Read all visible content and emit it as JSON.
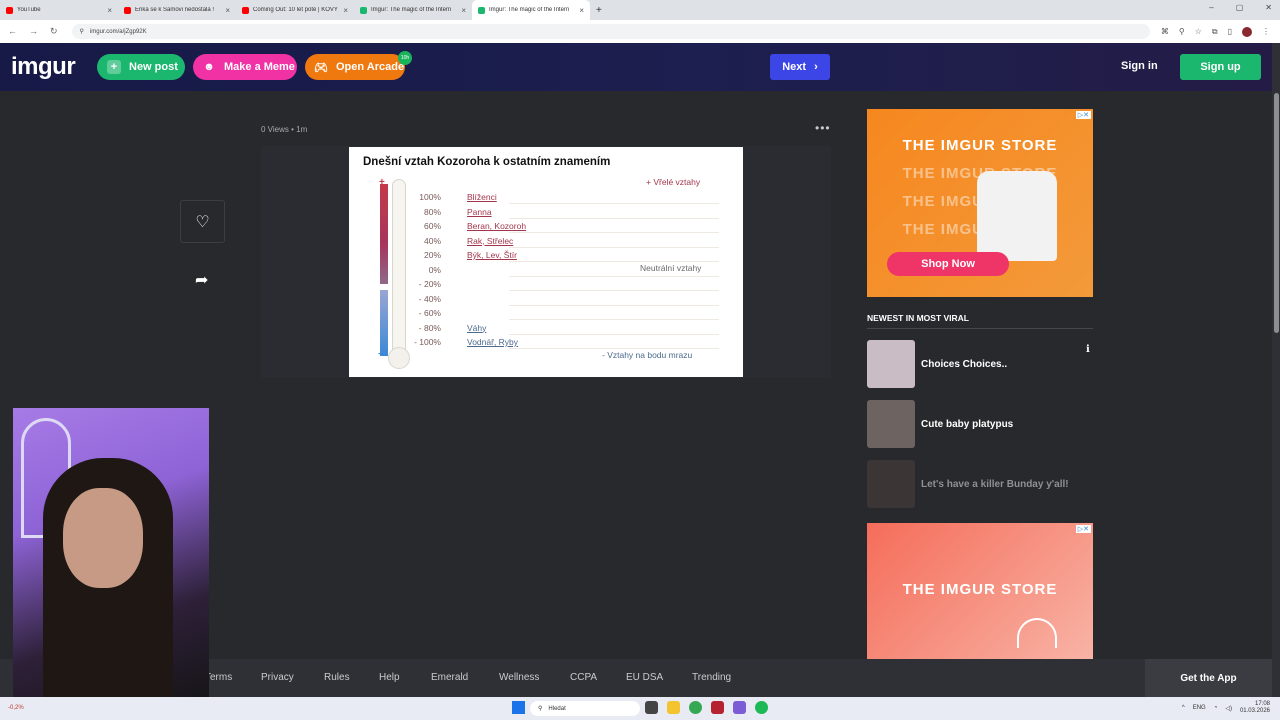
{
  "browser": {
    "tabs": [
      {
        "title": "YouTube",
        "color": "#ff0000",
        "active": false
      },
      {
        "title": "Erika se k Samovi nedostala !",
        "color": "#ff0000",
        "active": false
      },
      {
        "title": "Coming Out: 10 let poté | KOVY",
        "color": "#ff0000",
        "active": false
      },
      {
        "title": "Imgur: The magic of the Intern",
        "color": "#1bb76e",
        "active": false
      },
      {
        "title": "Imgur: The magic of the Intern",
        "color": "#1bb76e",
        "active": true
      }
    ],
    "url": "imgur.com/a/jZgp92K"
  },
  "header": {
    "logo": "imgur",
    "new_post": "New post",
    "make_meme": "Make a Meme",
    "open_arcade": "Open Arcade",
    "arcade_badge": "10h",
    "next": "Next",
    "sign_in": "Sign in",
    "sign_up": "Sign up"
  },
  "post": {
    "views": "0 Views",
    "age": "1m",
    "image": {
      "title": "Dnešní vztah Kozoroha k ostatním znamením",
      "label_top": "+ Vřelé vztahy",
      "label_mid": "Neutrální vztahy",
      "label_bottom": "- Vztahy na bodu mrazu",
      "rows": [
        {
          "pct": "100%",
          "signs": "Blíženci",
          "neg": false
        },
        {
          "pct": "80%",
          "signs": "Panna",
          "neg": false
        },
        {
          "pct": "60%",
          "signs": "Beran, Kozoroh",
          "neg": false
        },
        {
          "pct": "40%",
          "signs": "Rak, Střelec",
          "neg": false
        },
        {
          "pct": "20%",
          "signs": "Býk, Lev, Štír",
          "neg": false
        },
        {
          "pct": "0%",
          "signs": "",
          "neg": false
        },
        {
          "pct": "- 20%",
          "signs": "",
          "neg": true
        },
        {
          "pct": "- 40%",
          "signs": "",
          "neg": true
        },
        {
          "pct": "- 60%",
          "signs": "",
          "neg": true
        },
        {
          "pct": "- 80%",
          "signs": "Váhy",
          "neg": true
        },
        {
          "pct": "- 100%",
          "signs": "Vodnář, Ryby",
          "neg": true
        }
      ]
    }
  },
  "ads": {
    "store_text": "THE IMGUR STORE",
    "shop_now": "Shop Now"
  },
  "viral": {
    "heading": "NEWEST IN MOST VIRAL",
    "items": [
      {
        "title": "Choices Choices..",
        "thumb": "#c9bcc5",
        "dim": false
      },
      {
        "title": "Cute baby platypus",
        "thumb": "#6d6361",
        "dim": false
      },
      {
        "title": "Let's have a killer Bunday y'all!",
        "thumb": "#3b3536",
        "dim": true
      }
    ]
  },
  "footer": {
    "links": [
      "Terms",
      "Privacy",
      "Rules",
      "Help",
      "Emerald",
      "Wellness",
      "CCPA",
      "EU DSA",
      "Trending"
    ],
    "get_app": "Get the App"
  },
  "taskbar": {
    "search": "Hledat",
    "weather": "-0,2%",
    "lang": "ENG",
    "time": "17:08",
    "date": "01.03.2026"
  }
}
